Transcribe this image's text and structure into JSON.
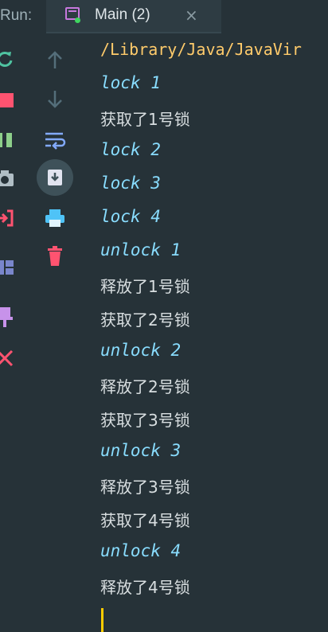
{
  "header": {
    "run_label": "Run:",
    "tab_label": "Main (2)",
    "tab_close": "×"
  },
  "toolbar": {
    "left": [
      "rerun-icon",
      "stop-icon",
      "pause-icon",
      "camera-icon",
      "exit-icon",
      "layout-icon",
      "pin-icon",
      "close-icon"
    ],
    "right": [
      "arrow-up-icon",
      "arrow-down-icon",
      "soft-wrap-icon",
      "scroll-to-end-icon",
      "print-icon",
      "trash-icon"
    ]
  },
  "colors": {
    "background": "#263238",
    "path": "#ffcb6b",
    "lock_text": "#89ddff",
    "plain_text": "#d8dee0",
    "caret": "#ffcc00"
  },
  "console": {
    "lines": [
      {
        "kind": "path",
        "text": "/Library/Java/JavaVir"
      },
      {
        "kind": "lock",
        "text": "lock 1"
      },
      {
        "kind": "text",
        "text": "获取了1号锁"
      },
      {
        "kind": "lock",
        "text": "lock 2"
      },
      {
        "kind": "lock",
        "text": "lock 3"
      },
      {
        "kind": "lock",
        "text": "lock 4"
      },
      {
        "kind": "lock",
        "text": "unlock 1"
      },
      {
        "kind": "text",
        "text": "释放了1号锁"
      },
      {
        "kind": "text",
        "text": "获取了2号锁"
      },
      {
        "kind": "lock",
        "text": "unlock 2"
      },
      {
        "kind": "text",
        "text": "释放了2号锁"
      },
      {
        "kind": "text",
        "text": "获取了3号锁"
      },
      {
        "kind": "lock",
        "text": "unlock 3"
      },
      {
        "kind": "text",
        "text": "释放了3号锁"
      },
      {
        "kind": "text",
        "text": "获取了4号锁"
      },
      {
        "kind": "lock",
        "text": "unlock 4"
      },
      {
        "kind": "text",
        "text": "释放了4号锁"
      }
    ]
  }
}
